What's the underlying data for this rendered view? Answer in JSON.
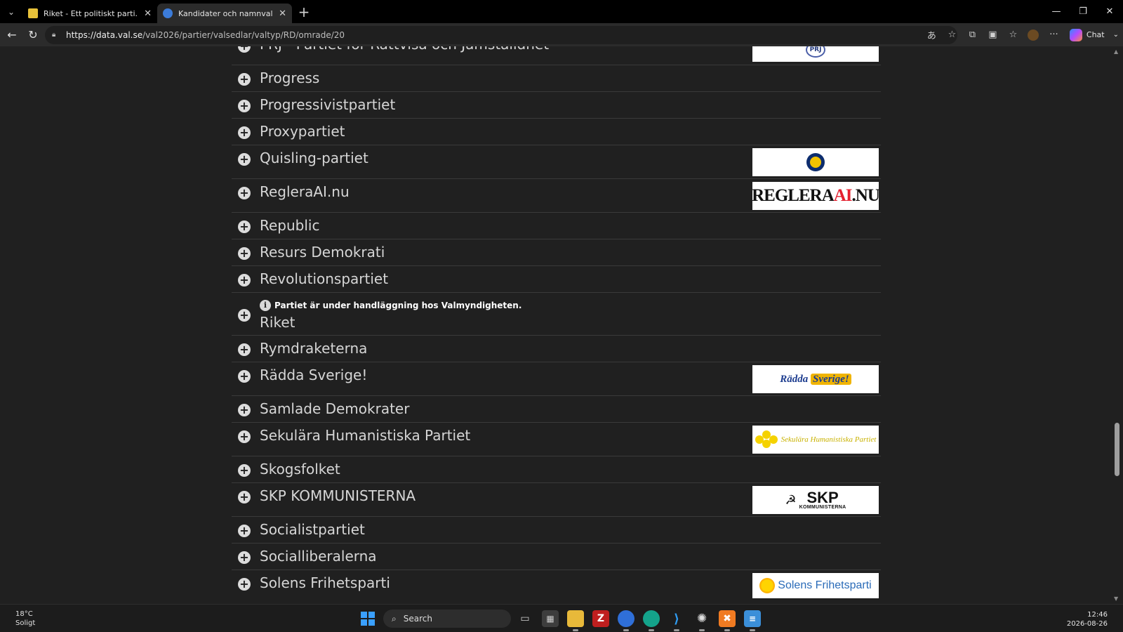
{
  "browser": {
    "tabs": [
      {
        "title": "Riket - Ett politiskt parti. Gör Sverig",
        "active": false,
        "favicon_color": "#e8c23a"
      },
      {
        "title": "Kandidater och namnvalsedlar | Va",
        "active": true,
        "favicon_color": "#3c7cd9"
      }
    ],
    "url_host": "https://data.val.se",
    "url_path": "/val2026/partier/valsedlar/valtyp/RD/omrade/20",
    "chat_label": "Chat"
  },
  "parties": [
    {
      "name": "PRJ - Partiet för Rättvisa och Jämställdhet",
      "logo": "prj",
      "logo_text": "PRJ"
    },
    {
      "name": "Progress"
    },
    {
      "name": "Progressivistpartiet"
    },
    {
      "name": "Proxypartiet"
    },
    {
      "name": "Quisling-partiet",
      "logo": "quisling"
    },
    {
      "name": "RegleraAI.nu",
      "logo": "regleraai",
      "logo_text_a": "REGLERA",
      "logo_text_b": "AI",
      "logo_text_c": ".NU"
    },
    {
      "name": "Republic"
    },
    {
      "name": "Resurs Demokrati"
    },
    {
      "name": "Revolutionspartiet"
    },
    {
      "name": "Riket",
      "notice": "Partiet är under handläggning hos Valmyndigheten."
    },
    {
      "name": "Rymdraketerna"
    },
    {
      "name": "Rädda Sverige!",
      "logo": "raddasv",
      "logo_text_a": "Rädda",
      "logo_text_b": "Sverige!"
    },
    {
      "name": "Samlade Demokrater"
    },
    {
      "name": "Sekulära Humanistiska Partiet",
      "logo": "shp",
      "logo_text": "Sekulära Humanistiska Partiet"
    },
    {
      "name": "Skogsfolket"
    },
    {
      "name": "SKP KOMMUNISTERNA",
      "logo": "skp",
      "logo_text_a": "SKP",
      "logo_text_b": "KOMMUNISTERNA"
    },
    {
      "name": "Socialistpartiet"
    },
    {
      "name": "Socialliberalerna"
    },
    {
      "name": "Solens Frihetsparti",
      "logo": "solens",
      "logo_text": "Solens Frihetsparti"
    }
  ],
  "taskbar": {
    "weather_temp": "18°C",
    "weather_desc": "Soligt",
    "search_placeholder": "Search",
    "time": "12:46",
    "date": "2026-08-26"
  }
}
